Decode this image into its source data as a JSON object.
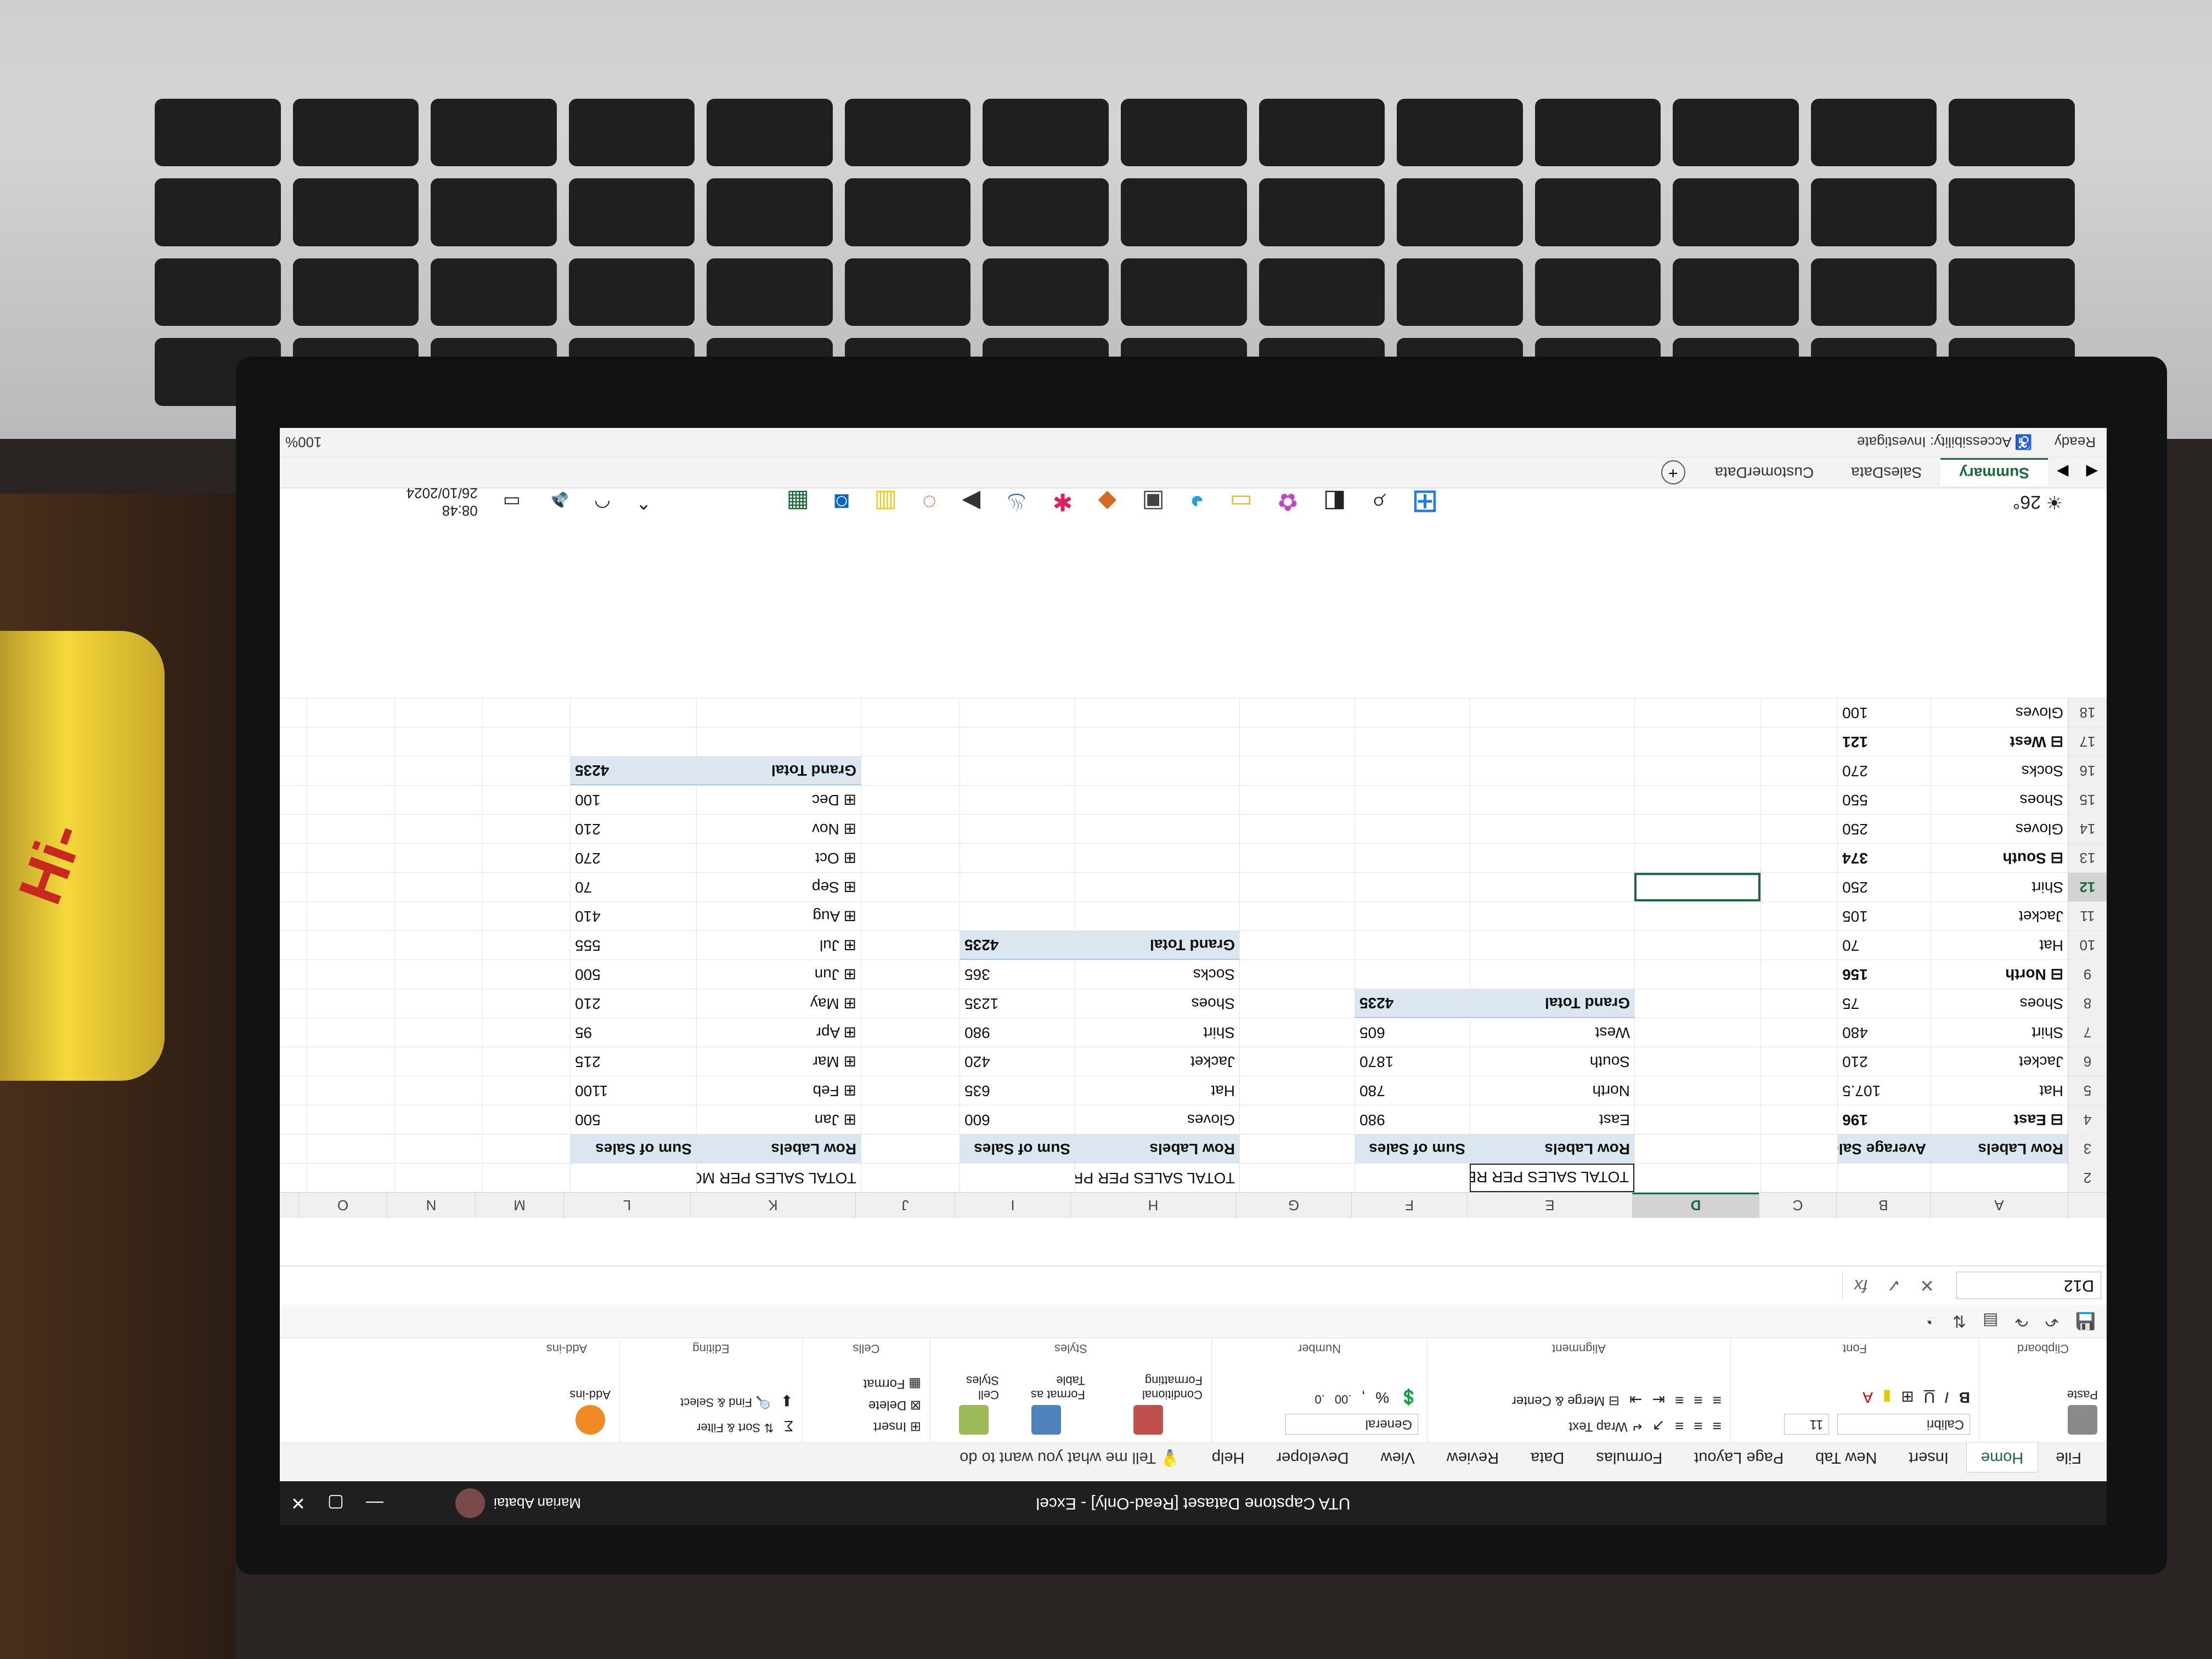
{
  "window": {
    "title": "UTA Capstone Dataset [Read-Only] - Excel",
    "user": "Marian Abatai",
    "controls": [
      "—",
      "▢",
      "✕"
    ]
  },
  "menu": {
    "tabs": [
      "File",
      "Home",
      "Insert",
      "New Tab",
      "Page Layout",
      "Formulas",
      "Data",
      "Review",
      "View",
      "Developer",
      "Help"
    ],
    "active": "Home",
    "tell_me": "Tell me what you want to do"
  },
  "ribbon": {
    "clipboard": {
      "label": "Clipboard",
      "paste": "Paste"
    },
    "font": {
      "label": "Font",
      "name": "Calibri",
      "size": "11"
    },
    "alignment": {
      "label": "Alignment",
      "wrap": "Wrap Text",
      "merge": "Merge & Center"
    },
    "number": {
      "label": "Number",
      "format": "General"
    },
    "styles": {
      "label": "Styles",
      "conditional": "Conditional Formatting",
      "format_as_table": "Format as Table",
      "cell_styles": "Cell Styles"
    },
    "cells": {
      "label": "Cells",
      "insert": "Insert",
      "delete": "Delete",
      "format": "Format"
    },
    "editing": {
      "label": "Editing",
      "sort": "Sort & Filter",
      "find": "Find & Select"
    },
    "addins": {
      "label": "Add-ins",
      "addins": "Add-ins"
    }
  },
  "formula_bar": {
    "name_box": "D12",
    "fx": "fx",
    "content": ""
  },
  "columns": [
    "A",
    "B",
    "C",
    "D",
    "E",
    "F",
    "G",
    "H",
    "I",
    "J",
    "K",
    "L",
    "M",
    "N",
    "O"
  ],
  "selected_column": "D",
  "selected_row": "12",
  "rows": [
    {
      "n": "2",
      "cells": {
        "E": "TOTAL SALES PER REGION",
        "H": "TOTAL SALES PER PRODUCT",
        "K": "TOTAL SALES PER MONTH"
      }
    },
    {
      "n": "3",
      "cells": {
        "A": "Row Labels",
        "B": "Average Sales",
        "E": "Row Labels",
        "F": "Sum of Sales",
        "H": "Row Labels",
        "I": "Sum of Sales",
        "K": "Row Labels",
        "L": "Sum of Sales"
      }
    },
    {
      "n": "4",
      "cells": {
        "A": "⊟ East",
        "B": "196",
        "E": "East",
        "F": "980",
        "H": "Gloves",
        "I": "600",
        "K": "⊞ Jan",
        "L": "500"
      }
    },
    {
      "n": "5",
      "cells": {
        "A": "Hat",
        "B": "107.5",
        "E": "North",
        "F": "780",
        "H": "Hat",
        "I": "635",
        "K": "⊞ Feb",
        "L": "1100"
      }
    },
    {
      "n": "6",
      "cells": {
        "A": "Jacket",
        "B": "210",
        "E": "South",
        "F": "1870",
        "H": "Jacket",
        "I": "420",
        "K": "⊞ Mar",
        "L": "215"
      }
    },
    {
      "n": "7",
      "cells": {
        "A": "Shirt",
        "B": "480",
        "E": "West",
        "F": "605",
        "H": "Shirt",
        "I": "980",
        "K": "⊞ Apr",
        "L": "95"
      }
    },
    {
      "n": "8",
      "cells": {
        "A": "Shoes",
        "B": "75",
        "E": "Grand Total",
        "F": "4235",
        "H": "Shoes",
        "I": "1235",
        "K": "⊞ May",
        "L": "210"
      }
    },
    {
      "n": "9",
      "cells": {
        "A": "⊟ North",
        "B": "156",
        "H": "Socks",
        "I": "365",
        "K": "⊞ Jun",
        "L": "500"
      }
    },
    {
      "n": "10",
      "cells": {
        "A": "Hat",
        "B": "70",
        "H": "Grand Total",
        "I": "4235",
        "K": "⊞ Jul",
        "L": "555"
      }
    },
    {
      "n": "11",
      "cells": {
        "A": "Jacket",
        "B": "105",
        "K": "⊞ Aug",
        "L": "410"
      }
    },
    {
      "n": "12",
      "cells": {
        "A": "Shirt",
        "B": "250",
        "K": "⊞ Sep",
        "L": "70"
      }
    },
    {
      "n": "13",
      "cells": {
        "A": "⊟ South",
        "B": "374",
        "K": "⊞ Oct",
        "L": "270"
      }
    },
    {
      "n": "14",
      "cells": {
        "A": "Gloves",
        "B": "250",
        "K": "⊞ Nov",
        "L": "210"
      }
    },
    {
      "n": "15",
      "cells": {
        "A": "Shoes",
        "B": "550",
        "K": "⊞ Dec",
        "L": "100"
      }
    },
    {
      "n": "16",
      "cells": {
        "A": "Socks",
        "B": "270",
        "K": "Grand Total",
        "L": "4235"
      }
    },
    {
      "n": "17",
      "cells": {
        "A": "⊟ West",
        "B": "121"
      }
    },
    {
      "n": "18",
      "cells": {
        "A": "Gloves",
        "B": "100"
      }
    }
  ],
  "sheet_tabs": [
    "Summary",
    "SalesData",
    "CustomerData"
  ],
  "active_sheet": "Summary",
  "status": {
    "ready": "Ready",
    "accessibility": "Accessibility: Investigate",
    "zoom": "100%"
  },
  "taskbar": {
    "weather": "26°",
    "time": "08:48",
    "date": "26/10/2024"
  },
  "colors": {
    "excel_green": "#1a6b3c",
    "pivot_header": "#dce6f1"
  }
}
